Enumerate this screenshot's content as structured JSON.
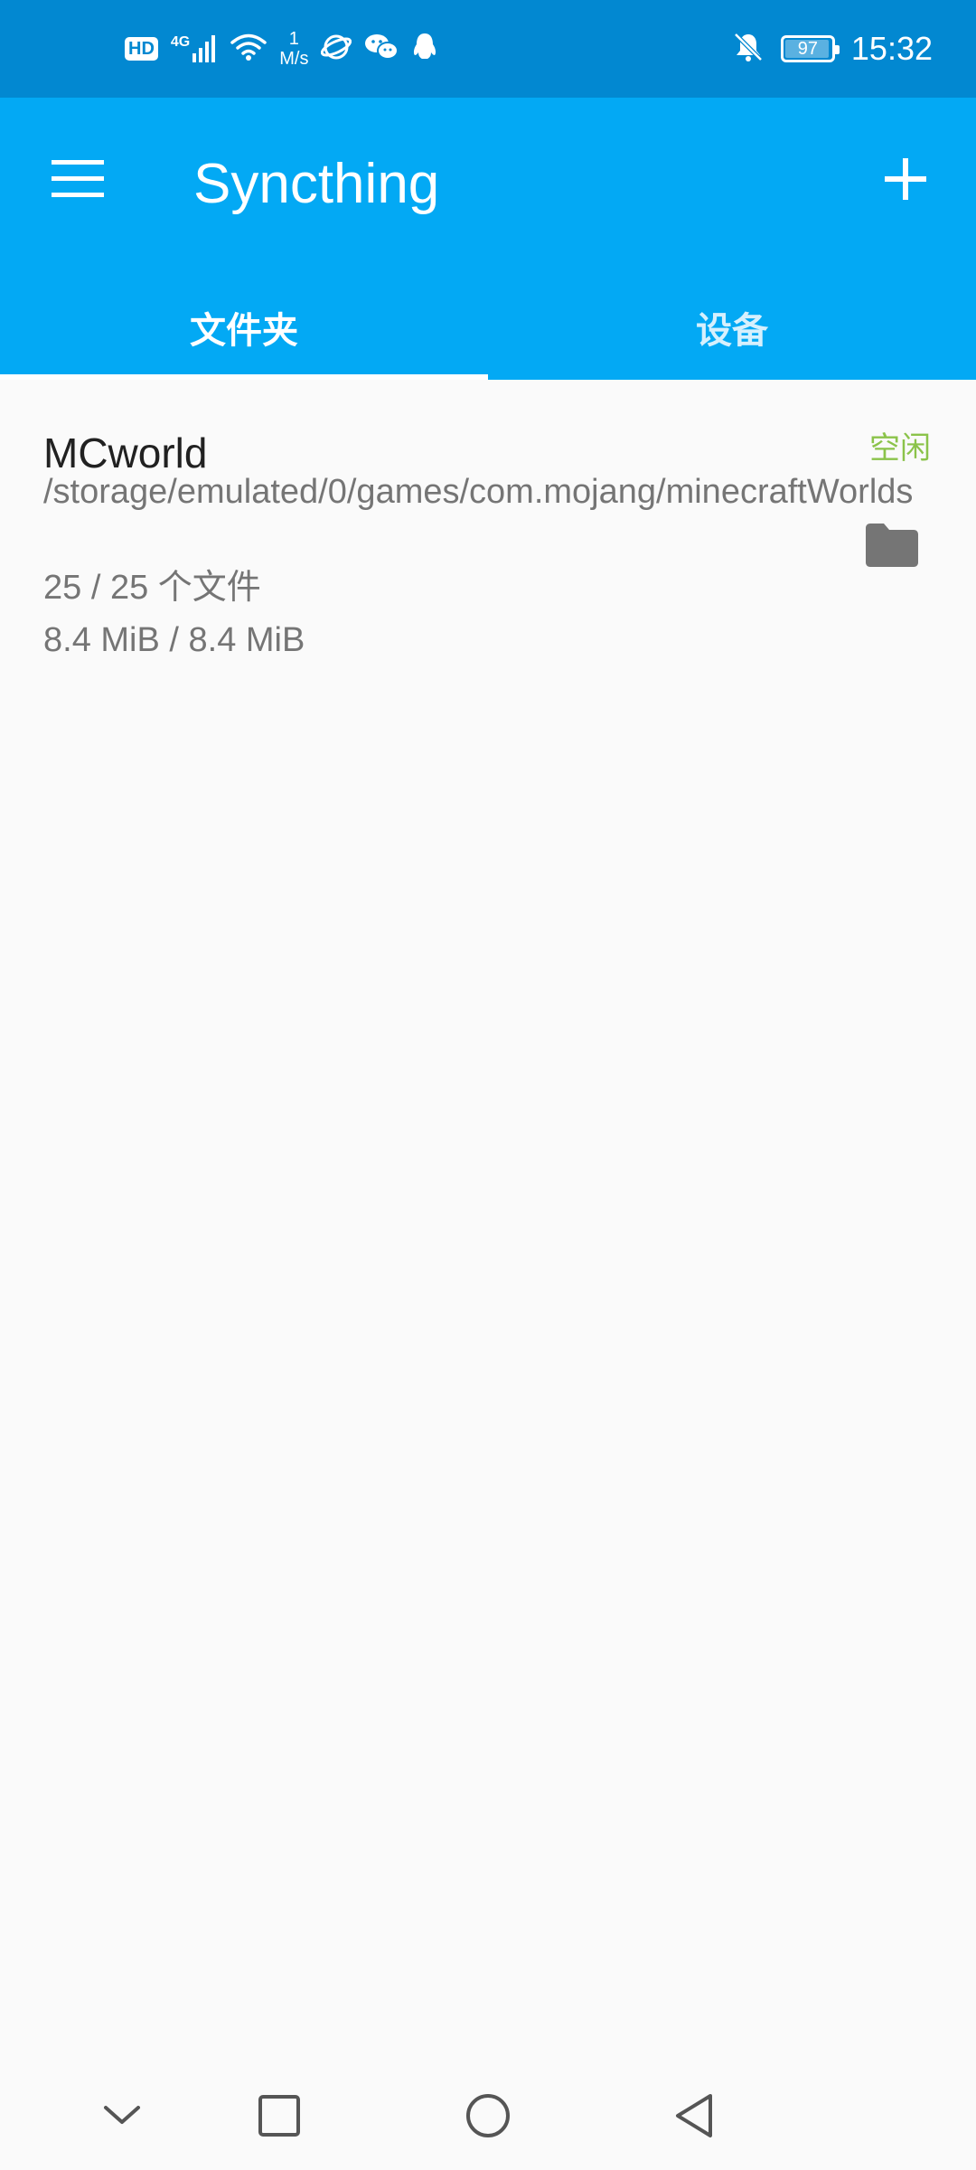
{
  "status_bar": {
    "hd_label": "HD",
    "network_type": "4G",
    "net_speed_value": "1",
    "net_speed_unit": "M/s",
    "battery_level": "97",
    "time": "15:32",
    "icons": [
      "hd-icon",
      "signal-4g-icon",
      "wifi-icon",
      "browser-icon",
      "wechat-icon",
      "qq-icon",
      "mute-bell-icon",
      "battery-icon"
    ]
  },
  "app_bar": {
    "title": "Syncthing",
    "colors": {
      "primary": "#03a9f4",
      "primary_dark": "#0288d1",
      "accent_status": "#8bc34a"
    }
  },
  "tabs": [
    {
      "label": "文件夹",
      "active": true
    },
    {
      "label": "设备",
      "active": false
    }
  ],
  "folders": [
    {
      "name": "MCworld",
      "path": "/storage/emulated/0/games/com.mojang/minecraftWorlds",
      "files": "25 / 25 个文件",
      "size": "8.4 MiB / 8.4 MiB",
      "status": "空闲"
    }
  ],
  "nav_bar": {
    "icons": [
      "collapse-chevron-icon",
      "recents-square-icon",
      "home-circle-icon",
      "back-triangle-icon"
    ]
  }
}
